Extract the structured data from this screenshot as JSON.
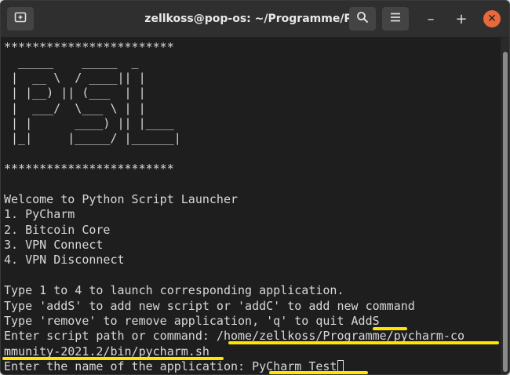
{
  "window": {
    "title": "zellkoss@pop-os: ~/Programme/PSL",
    "icons": {
      "new_tab": "new-tab-icon",
      "search": "search-icon",
      "menu": "hamburger-menu-icon",
      "minimize": "minimize-icon",
      "maximize": "maximize-icon",
      "close": "close-icon"
    },
    "minimize_label": "–",
    "maximize_label": "+",
    "close_label": "✕"
  },
  "terminal": {
    "lines": [
      "************************",
      "  _____    _____  _",
      " |  __ \\  / ____|| |",
      " | |__) || (___  | |",
      " |  ___/  \\___ \\ | |",
      " | |      ____) || |____",
      " |_|     |_____/ |______|",
      "",
      "************************",
      "",
      "Welcome to Python Script Launcher",
      "1. PyCharm",
      "2. Bitcoin Core",
      "3. VPN Connect",
      "4. VPN Disconnect",
      "",
      "Type 1 to 4 to launch corresponding application.",
      "Type 'addS' to add new script or 'addC' to add new command",
      "Type 'remove' to remove application, 'q' to quit AddS",
      "Enter script path or command: /home/zellkoss/Programme/pycharm-co",
      "mmunity-2021.2/bin/pycharm.sh",
      "Enter the name of the application: PyCharm Test"
    ]
  },
  "colors": {
    "terminal_bg": "#1e1e1e",
    "terminal_fg": "#d8d8d8",
    "titlebar_bg": "#2f2f2f",
    "close_button": "#e8693a",
    "highlight": "#ffe500"
  }
}
